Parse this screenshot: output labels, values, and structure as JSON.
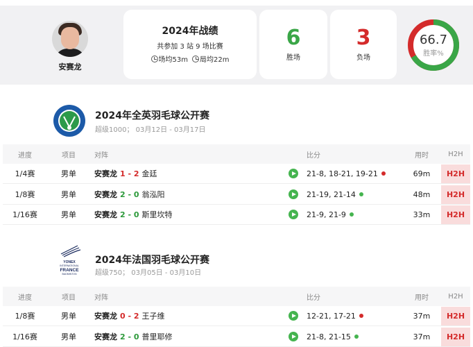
{
  "player": {
    "name": "安赛龙"
  },
  "summary": {
    "title": "2024年战绩",
    "subtitle": "共参加 3 站 9 场比赛",
    "avg_match": "场均53m",
    "avg_game": "局均22m",
    "wins": "6",
    "wins_label": "胜场",
    "losses": "3",
    "losses_label": "负场",
    "win_rate": "66.7",
    "win_rate_label": "胜率%",
    "win_rate_value": 66.7,
    "colors": {
      "win": "#3aa647",
      "loss": "#d42b2b"
    }
  },
  "columns": {
    "round": "进度",
    "event": "项目",
    "match": "对阵",
    "score": "比分",
    "time": "用时",
    "h2h": "H2H"
  },
  "tournaments": [
    {
      "title": "2024年全英羽毛球公开赛",
      "meta": "超级1000；  03月12日 - 03月17日",
      "logo": "all-england-logo",
      "rows": [
        {
          "round": "1/4赛",
          "event": "男单",
          "player": "安赛龙",
          "result": "1 - 2",
          "won": false,
          "opponent": "金廷",
          "score": "21-8, 18-21, 19-21",
          "time": "69m",
          "h2h": "H2H"
        },
        {
          "round": "1/8赛",
          "event": "男单",
          "player": "安赛龙",
          "result": "2 - 0",
          "won": true,
          "opponent": "翁泓阳",
          "score": "21-19, 21-14",
          "time": "48m",
          "h2h": "H2H"
        },
        {
          "round": "1/16赛",
          "event": "男单",
          "player": "安赛龙",
          "result": "2 - 0",
          "won": true,
          "opponent": "斯里坎特",
          "score": "21-9, 21-9",
          "time": "33m",
          "h2h": "H2H"
        }
      ]
    },
    {
      "title": "2024年法国羽毛球公开赛",
      "meta": "超级750；  03月05日 - 03月10日",
      "logo": "yonex-french-open-logo",
      "logo_text": {
        "brand": "YONEX",
        "line": "INTERNATIONAL",
        "country": "FRANCE",
        "sport": "BADMINTON"
      },
      "rows": [
        {
          "round": "1/8赛",
          "event": "男单",
          "player": "安赛龙",
          "result": "0 - 2",
          "won": false,
          "opponent": "王子维",
          "score": "12-21, 17-21",
          "time": "37m",
          "h2h": "H2H"
        },
        {
          "round": "1/16赛",
          "event": "男单",
          "player": "安赛龙",
          "result": "2 - 0",
          "won": true,
          "opponent": "普里耶修",
          "score": "21-8, 21-15",
          "time": "37m",
          "h2h": "H2H"
        }
      ]
    }
  ]
}
